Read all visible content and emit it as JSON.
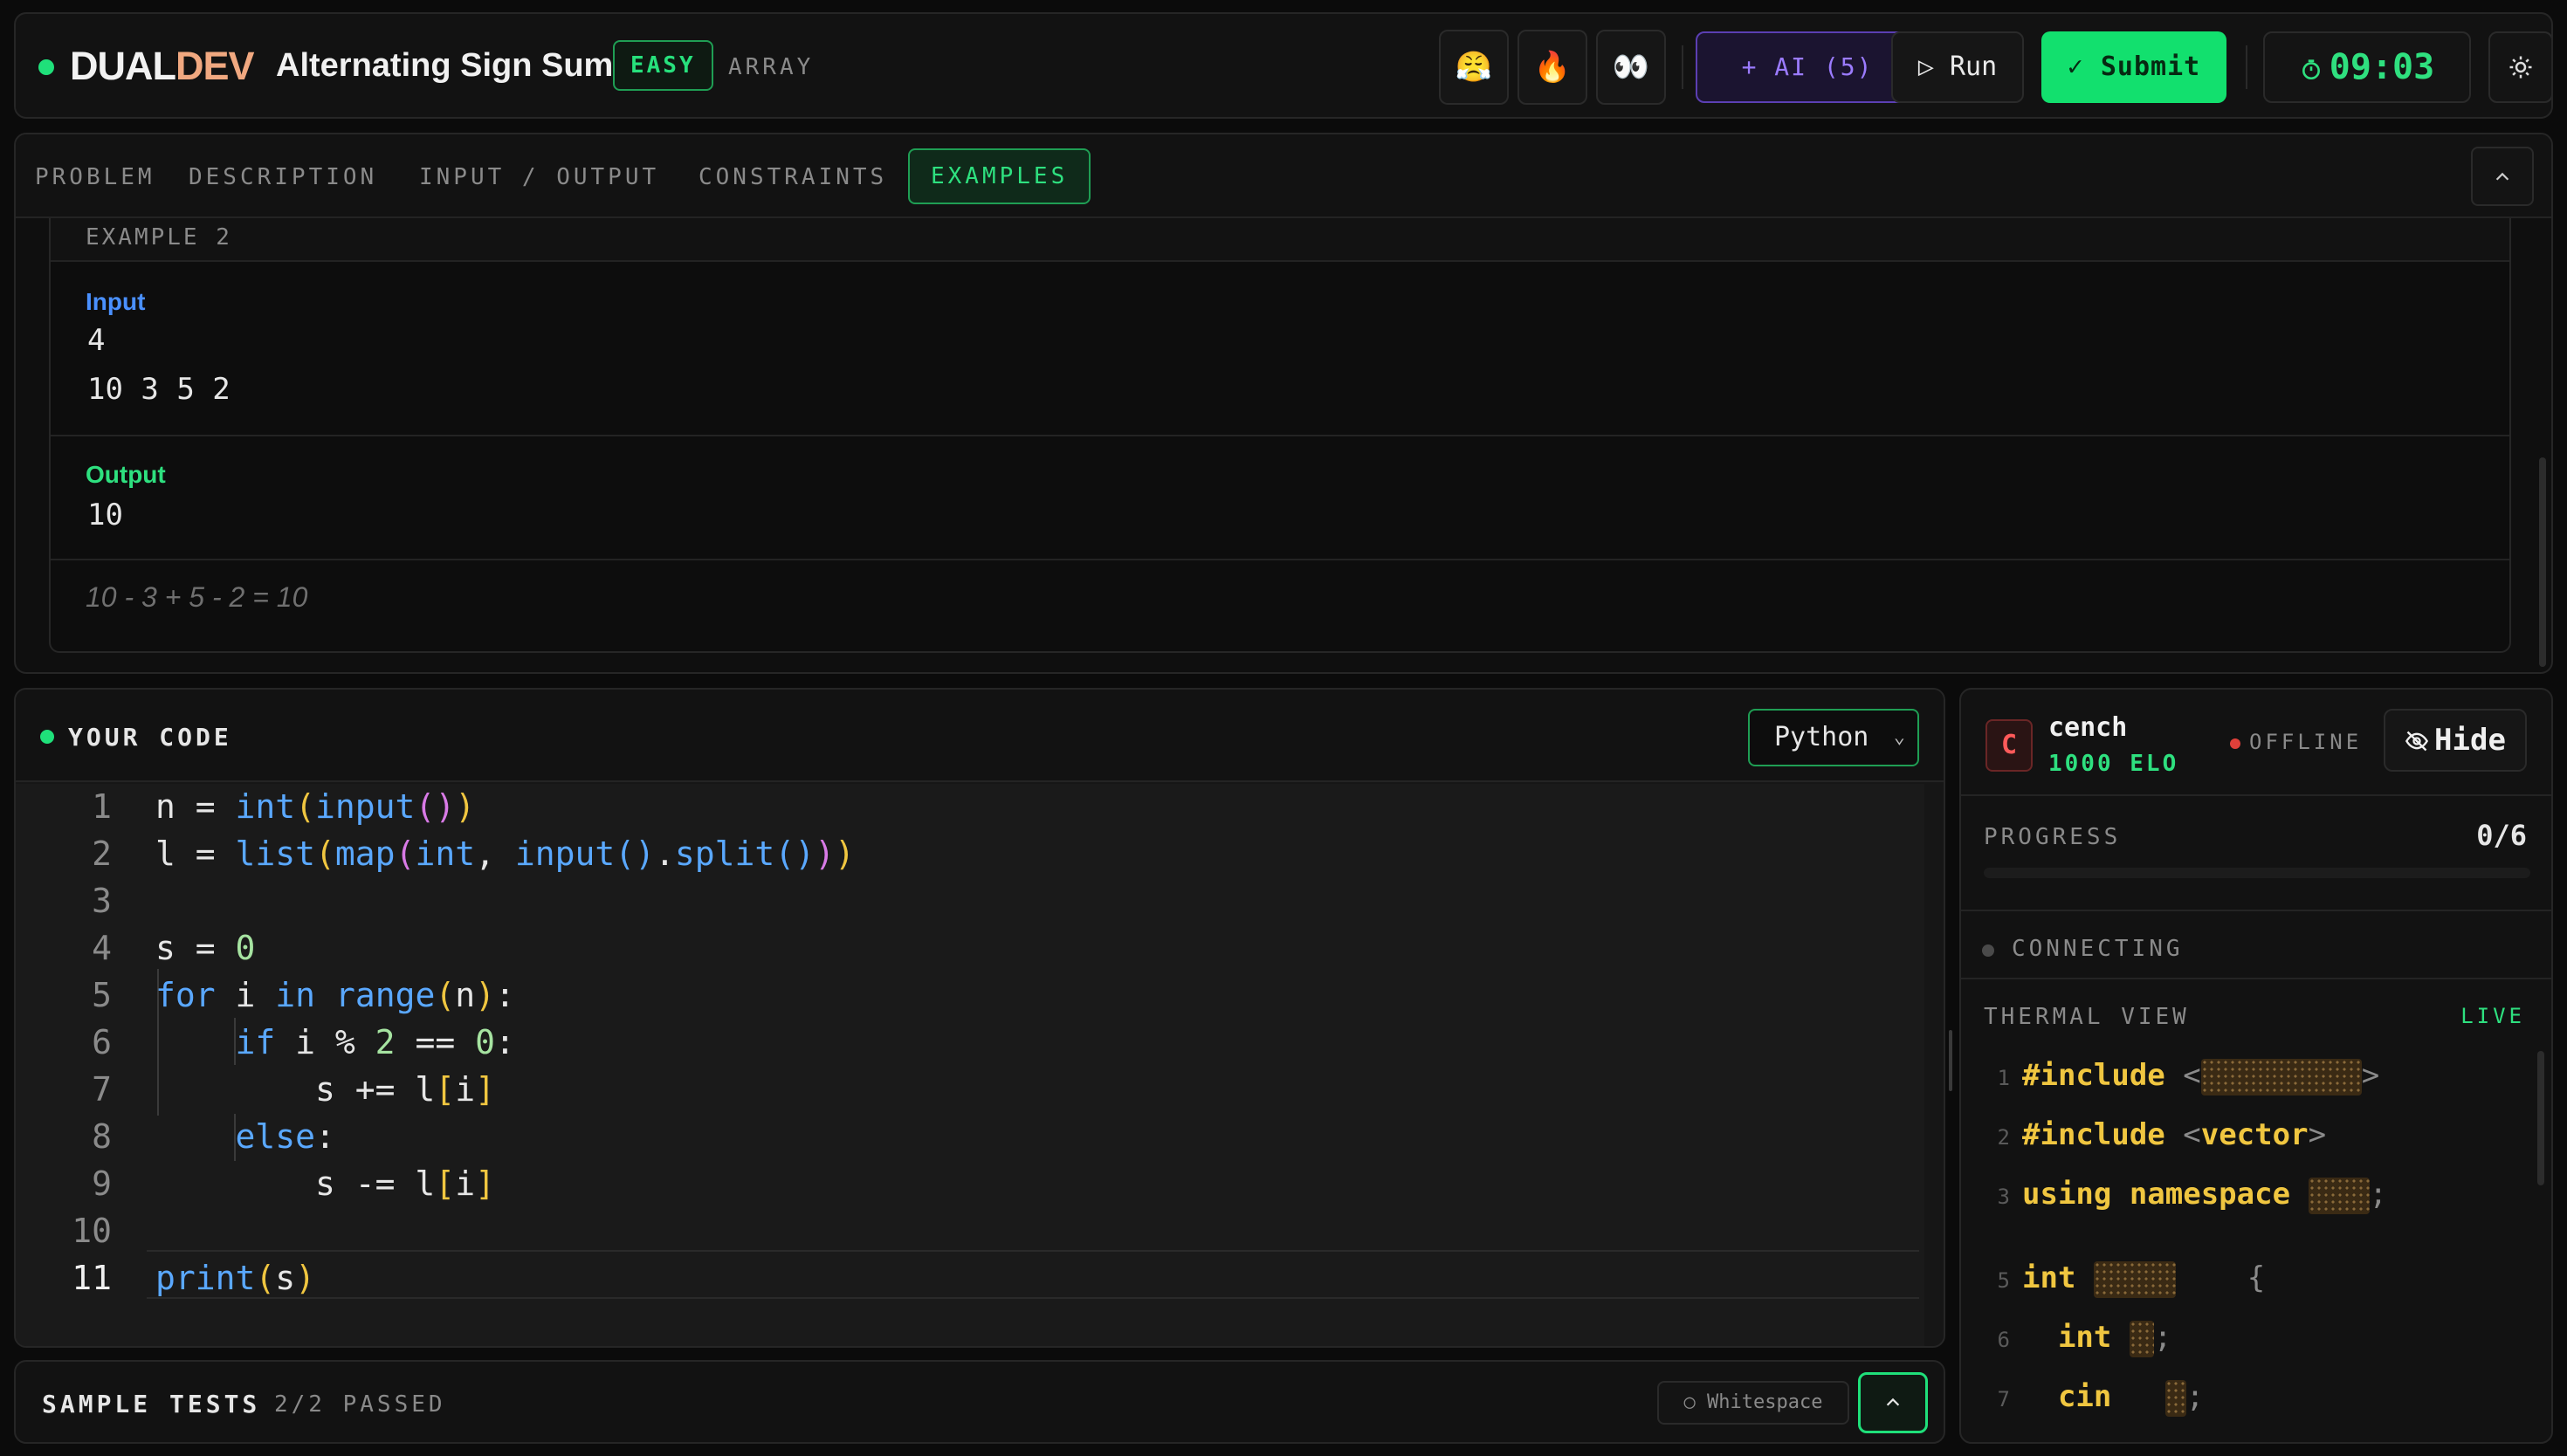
{
  "header": {
    "logo_a": "DUAL",
    "logo_b": "DEV",
    "problem_title": "Alternating Sign Sum",
    "difficulty": "EASY",
    "category": "ARRAY",
    "reactions": [
      "😤",
      "🔥",
      "👀"
    ],
    "ai_label": "+ AI (5)",
    "run_label": "▷ Run",
    "submit_label": "✓ Submit",
    "timer": "09:03",
    "timer_icon": "stopwatch-icon",
    "settings_icon": "sun-icon"
  },
  "problem": {
    "tabs": [
      "PROBLEM",
      "DESCRIPTION",
      "INPUT / OUTPUT",
      "CONSTRAINTS",
      "EXAMPLES"
    ],
    "active_tab": "EXAMPLES",
    "example": {
      "heading": "EXAMPLE 2",
      "input_label": "Input",
      "input_lines": [
        "4",
        "10 3 5 2"
      ],
      "output_label": "Output",
      "output_lines": [
        "10"
      ],
      "explanation": "10 - 3 + 5 - 2 = 10"
    }
  },
  "editor": {
    "title": "YOUR CODE",
    "language": "Python",
    "line_numbers": [
      "1",
      "2",
      "3",
      "4",
      "5",
      "6",
      "7",
      "8",
      "9",
      "10",
      "11"
    ],
    "current_line": "11",
    "code_lines": [
      "n = int(input())",
      "l = list(map(int, input().split()))",
      "",
      "s = 0",
      "for i in range(n):",
      "    if i % 2 == 0:",
      "        s += l[i]",
      "    else:",
      "        s -= l[i]",
      "",
      "print(s)"
    ]
  },
  "tests": {
    "title": "SAMPLE TESTS",
    "status": "2/2 PASSED",
    "whitespace_label": "○ Whitespace"
  },
  "opponent": {
    "avatar_letter": "C",
    "name": "cench",
    "elo": "1000 ELO",
    "status": "OFFLINE",
    "hide_label": "Hide",
    "progress_label": "PROGRESS",
    "progress_value": "0/6",
    "progress_fraction": 0,
    "connection": "CONNECTING",
    "thermal_label": "THERMAL VIEW",
    "live_label": "LIVE",
    "thermal_lines": [
      {
        "n": "1",
        "text": "#include"
      },
      {
        "n": "2",
        "text": "#include"
      },
      {
        "n": "3",
        "text": "using namespace"
      },
      {
        "n": "5",
        "text": "int"
      },
      {
        "n": "6",
        "text": "int"
      },
      {
        "n": "7",
        "text": "cin"
      }
    ],
    "thermal_vector": "vector"
  },
  "colors": {
    "accent_green": "#12e06e",
    "ai_purple": "#9b7bff",
    "input_blue": "#4a90ff",
    "offline_red": "#e0403a"
  }
}
